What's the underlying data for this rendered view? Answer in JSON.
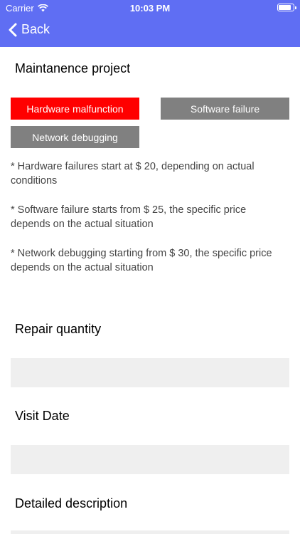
{
  "status_bar": {
    "carrier": "Carrier",
    "time": "10:03 PM"
  },
  "nav": {
    "back_label": "Back",
    "color": "#5f6ef3"
  },
  "maintenance": {
    "title": "Maintanence project",
    "options": [
      {
        "label": "Hardware malfunction",
        "selected": true
      },
      {
        "label": "Software failure",
        "selected": false
      },
      {
        "label": "Network debugging",
        "selected": false
      }
    ],
    "notes": [
      "* Hardware failures start at $ 20, depending on actual conditions",
      "* Software failure starts from $ 25, the specific price depends on the actual situation",
      "* Network debugging starting from $ 30, the specific price depends on the actual situation"
    ]
  },
  "form": {
    "repair_quantity_label": "Repair quantity",
    "repair_quantity_value": "",
    "visit_date_label": "Visit Date",
    "visit_date_value": "",
    "description_label": "Detailed description"
  },
  "colors": {
    "selected": "#ff0000",
    "unselected": "#808080",
    "input_bg": "#efefef"
  }
}
